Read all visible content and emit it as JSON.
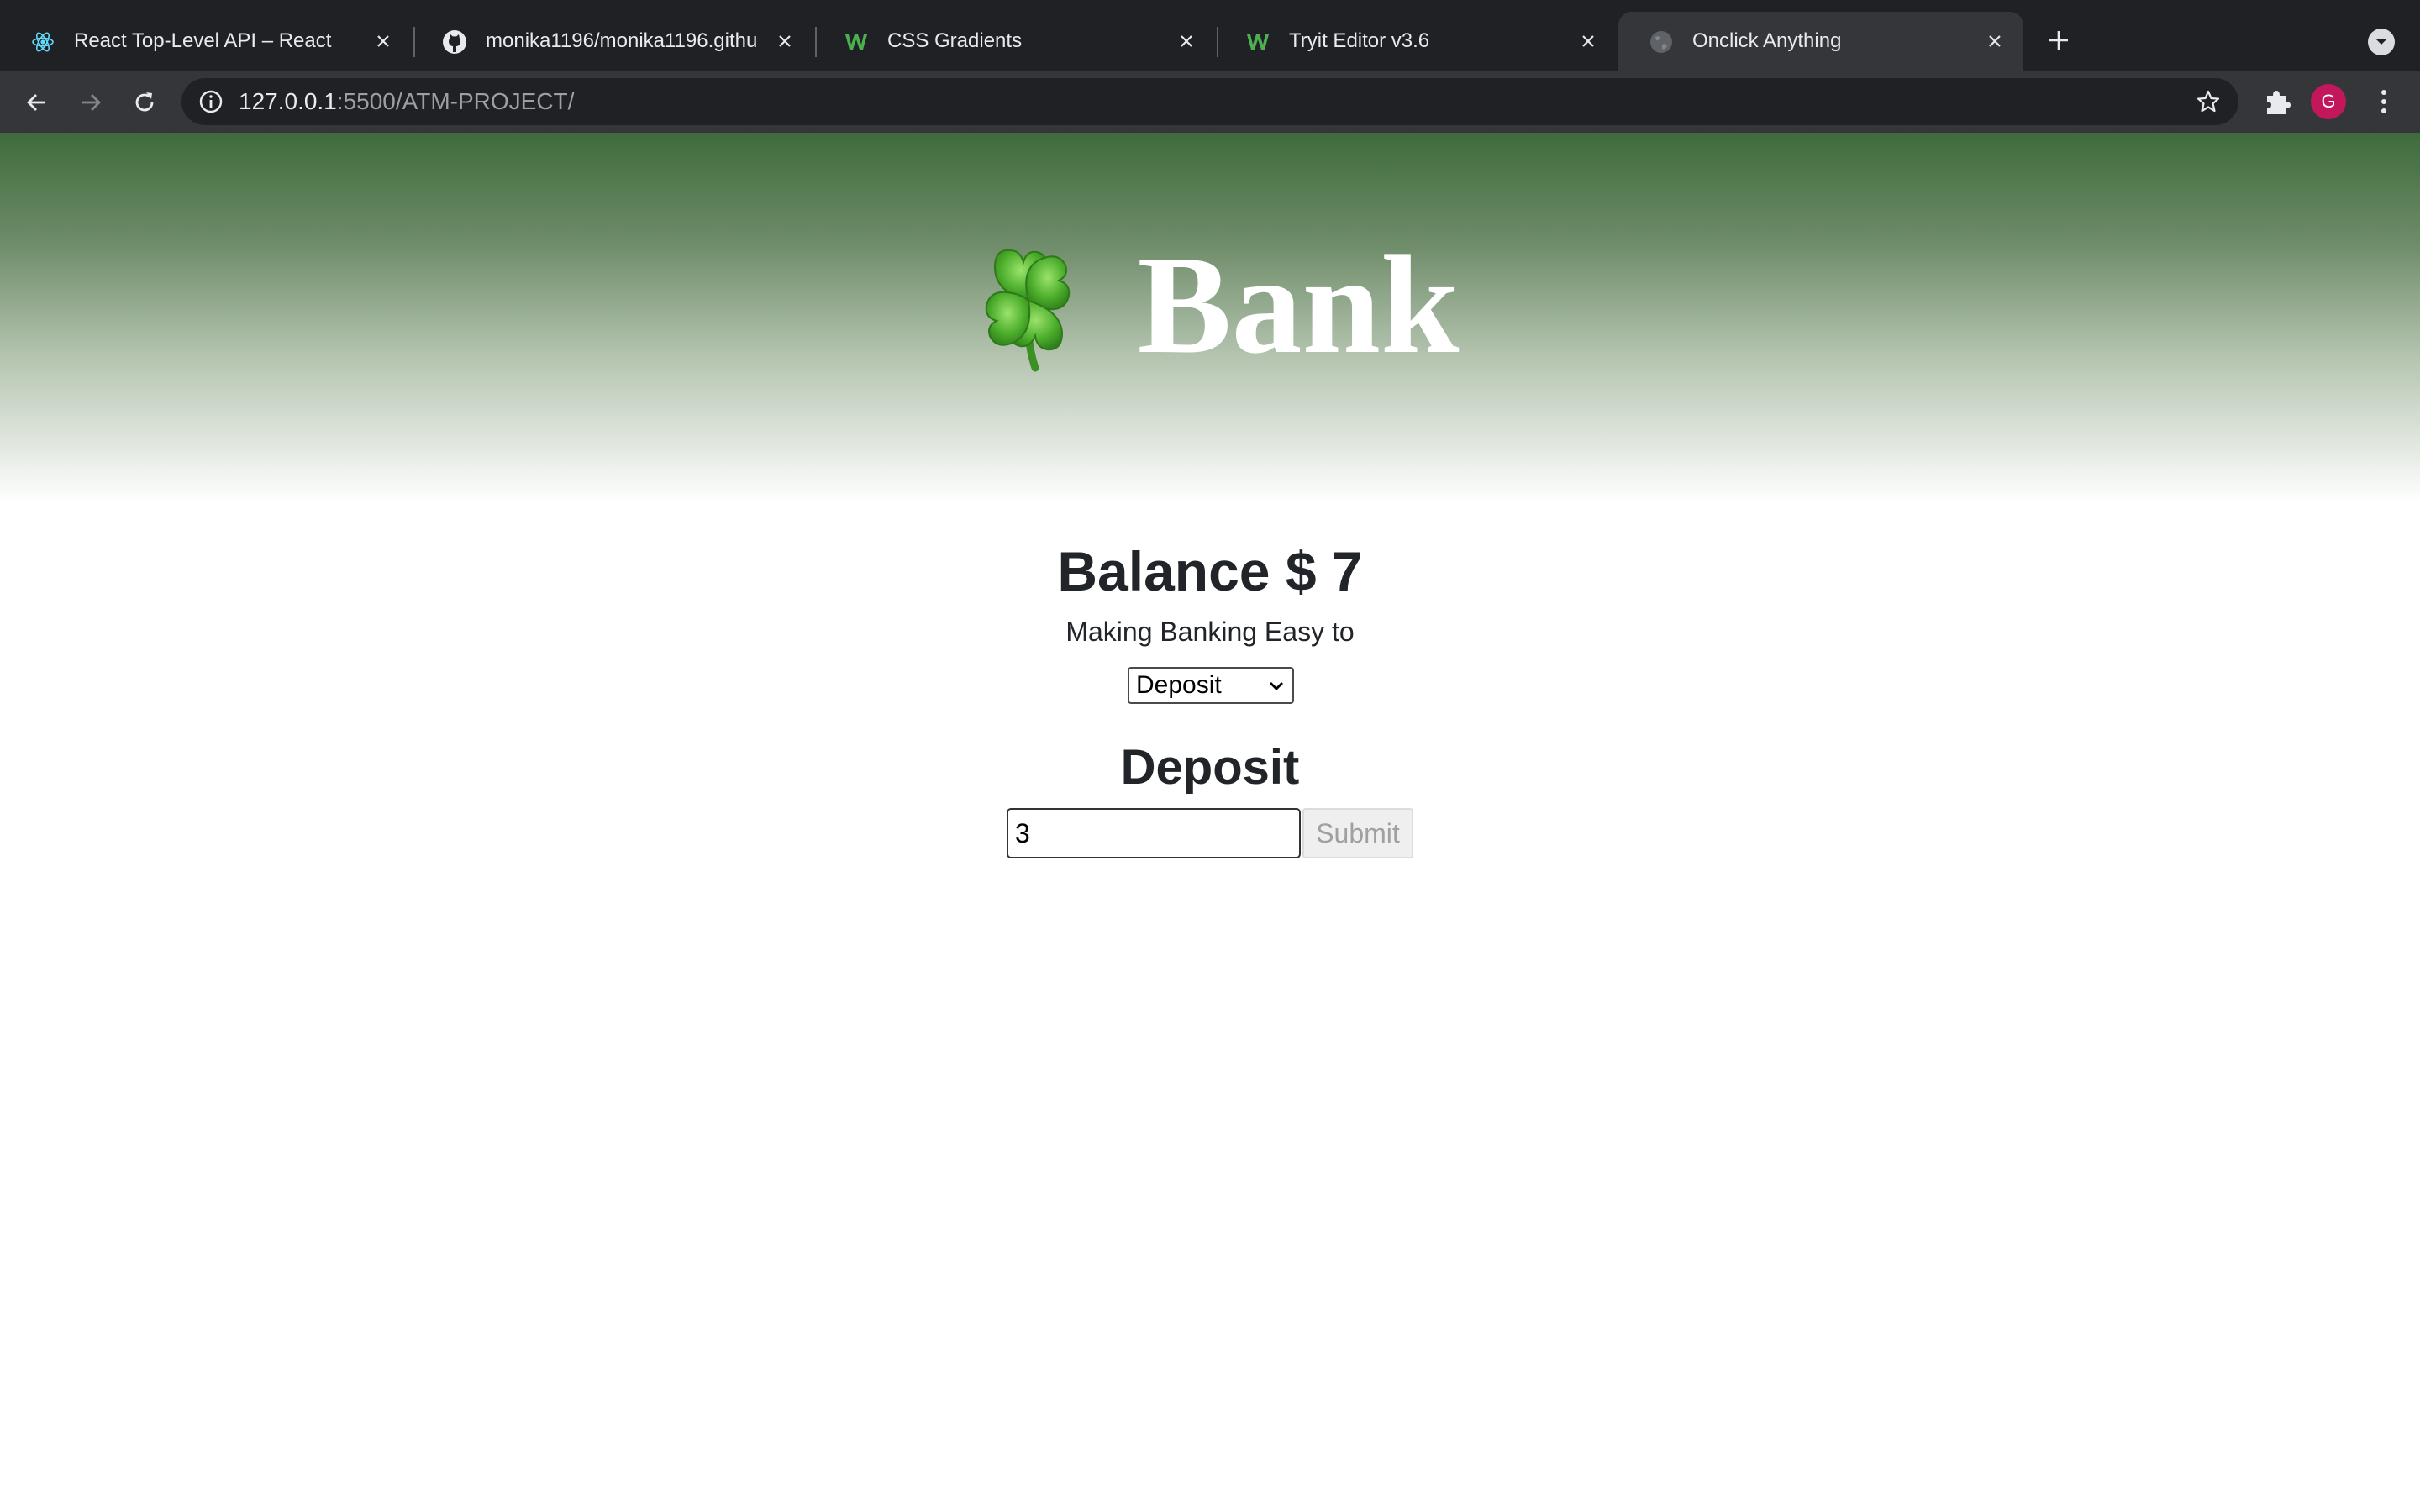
{
  "browser": {
    "tabs": [
      {
        "title": "React Top-Level API – React",
        "favicon": "react-icon",
        "active": false
      },
      {
        "title": "monika1196/monika1196.githu",
        "favicon": "github-icon",
        "active": false
      },
      {
        "title": "CSS Gradients",
        "favicon": "w3schools-icon",
        "active": false
      },
      {
        "title": "Tryit Editor v3.6",
        "favicon": "w3schools-icon",
        "active": false
      },
      {
        "title": "Onclick Anything",
        "favicon": "globe-icon",
        "active": true
      }
    ],
    "address": {
      "host": "127.0.0.1",
      "path": ":5500/ATM-PROJECT/"
    },
    "profile_initial": "G",
    "colors": {
      "chrome_dark": "#202124",
      "chrome_toolbar": "#35363a",
      "avatar": "#c2185b"
    }
  },
  "header": {
    "clover_icon": "four-leaf-clover-icon",
    "title": "Bank",
    "gradient_top": "#3f6b3c"
  },
  "main": {
    "balance_text": "Balance $ 7",
    "tagline": "Making Banking Easy to",
    "mode_select": {
      "selected": "Deposit"
    },
    "section_title": "Deposit",
    "amount_value": "3",
    "submit_label": "Submit"
  }
}
